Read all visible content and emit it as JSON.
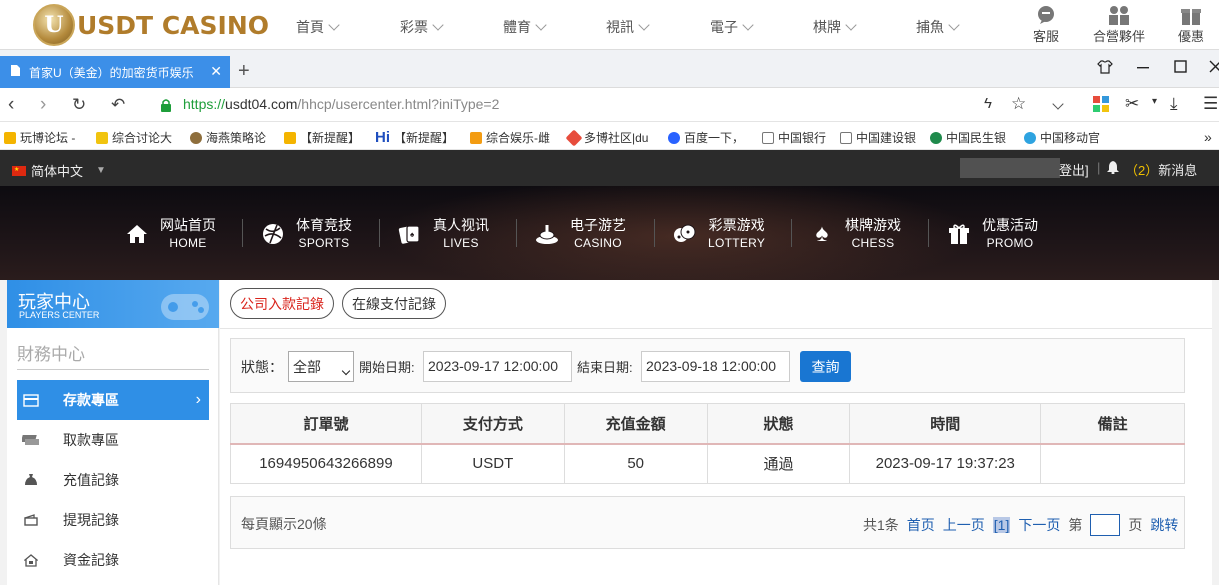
{
  "casino_nav": {
    "logo_letter": "U",
    "logo_text": "USDT CASINO",
    "items": [
      "首頁",
      "彩票",
      "體育",
      "視訊",
      "電子",
      "棋牌",
      "捕魚"
    ],
    "right": [
      "客服",
      "合營夥伴",
      "優惠"
    ]
  },
  "browser": {
    "tab_title": "首家U（美金）的加密货币娱乐",
    "url_scheme": "https://",
    "url_host": "usdt04.com",
    "url_path": "/hhcp/usercenter.html?iniType=2",
    "bookmarks": [
      "玩博论坛 -",
      "综合讨论大",
      "海燕策略论",
      "【新提醒】",
      "【新提醒】",
      "综合娱乐-雌",
      "多博社区|du",
      "百度一下，",
      "中国银行",
      "中国建设银",
      "中国民生银",
      "中国移动官"
    ]
  },
  "site_header": {
    "language": "简体中文",
    "logout": "登出]",
    "message_count": "（2）",
    "new_message": "新消息",
    "menu": [
      {
        "zh": "网站首页",
        "en": "HOME",
        "icon": "home-icon"
      },
      {
        "zh": "体育竞技",
        "en": "SPORTS",
        "icon": "ball-icon"
      },
      {
        "zh": "真人视讯",
        "en": "LIVES",
        "icon": "cards-icon"
      },
      {
        "zh": "电子游艺",
        "en": "CASINO",
        "icon": "slot-icon"
      },
      {
        "zh": "彩票游戏",
        "en": "LOTTERY",
        "icon": "dice-icon"
      },
      {
        "zh": "棋牌游戏",
        "en": "CHESS",
        "icon": "spade-icon"
      },
      {
        "zh": "优惠活动",
        "en": "PROMO",
        "icon": "gift-icon"
      }
    ]
  },
  "sidebar": {
    "title": "玩家中心",
    "subtitle": "PLAYERS CENTER",
    "section": "財務中心",
    "items": [
      {
        "label": "存款專區",
        "active": true,
        "arrow": "›"
      },
      {
        "label": "取款專區"
      },
      {
        "label": "充值記錄"
      },
      {
        "label": "提現記錄"
      },
      {
        "label": "資金記錄"
      }
    ]
  },
  "tabs": {
    "company": "公司入款記錄",
    "online": "在線支付記錄"
  },
  "filter": {
    "status_label": "狀態：",
    "status_value": "全部",
    "start_label": "開始日期:",
    "start_value": "2023-09-17 12:00:00",
    "end_label": "結束日期:",
    "end_value": "2023-09-18 12:00:00",
    "query": "查詢"
  },
  "table": {
    "headers": [
      "訂單號",
      "支付方式",
      "充值金額",
      "狀態",
      "時間",
      "備註"
    ],
    "rows": [
      [
        "1694950643266899",
        "USDT",
        "50",
        "通過",
        "2023-09-17 19:37:23",
        ""
      ]
    ]
  },
  "pager": {
    "per_page": "每頁顯示20條",
    "total": "共1条",
    "first": "首页",
    "prev": "上一页",
    "current": "[1]",
    "next": "下一页",
    "page_prefix": "第",
    "page_suffix": "页",
    "jump": "跳转"
  },
  "colors": {
    "accent": "#2f8fe6",
    "query_button": "#1976d2",
    "active_item": "#2f8fe6",
    "red_tab": "#d9241c",
    "link": "#1f5fb0"
  }
}
